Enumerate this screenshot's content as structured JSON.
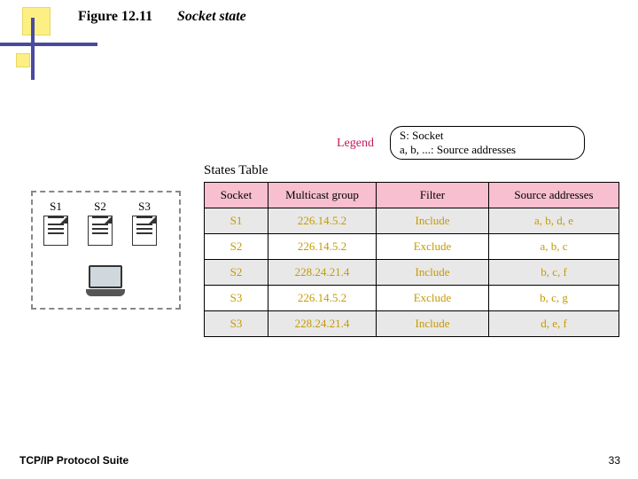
{
  "figure": {
    "number": "Figure 12.11",
    "title": "Socket state"
  },
  "legend": {
    "label": "Legend",
    "line1": "S: Socket",
    "line2": "a, b, ...: Source addresses"
  },
  "states_caption": "States Table",
  "table": {
    "headers": [
      "Socket",
      "Multicast group",
      "Filter",
      "Source addresses"
    ],
    "rows": [
      {
        "cells": [
          "S1",
          "226.14.5.2",
          "Include",
          "a, b, d, e"
        ]
      },
      {
        "cells": [
          "S2",
          "226.14.5.2",
          "Exclude",
          "a, b, c"
        ]
      },
      {
        "cells": [
          "S2",
          "228.24.21.4",
          "Include",
          "b, c, f"
        ]
      },
      {
        "cells": [
          "S3",
          "226.14.5.2",
          "Exclude",
          "b, c, g"
        ]
      },
      {
        "cells": [
          "S3",
          "228.24.21.4",
          "Include",
          "d, e, f"
        ]
      }
    ]
  },
  "diagram": {
    "sockets": [
      "S1",
      "S2",
      "S3"
    ]
  },
  "footer": {
    "text": "TCP/IP Protocol Suite",
    "page": "33"
  }
}
